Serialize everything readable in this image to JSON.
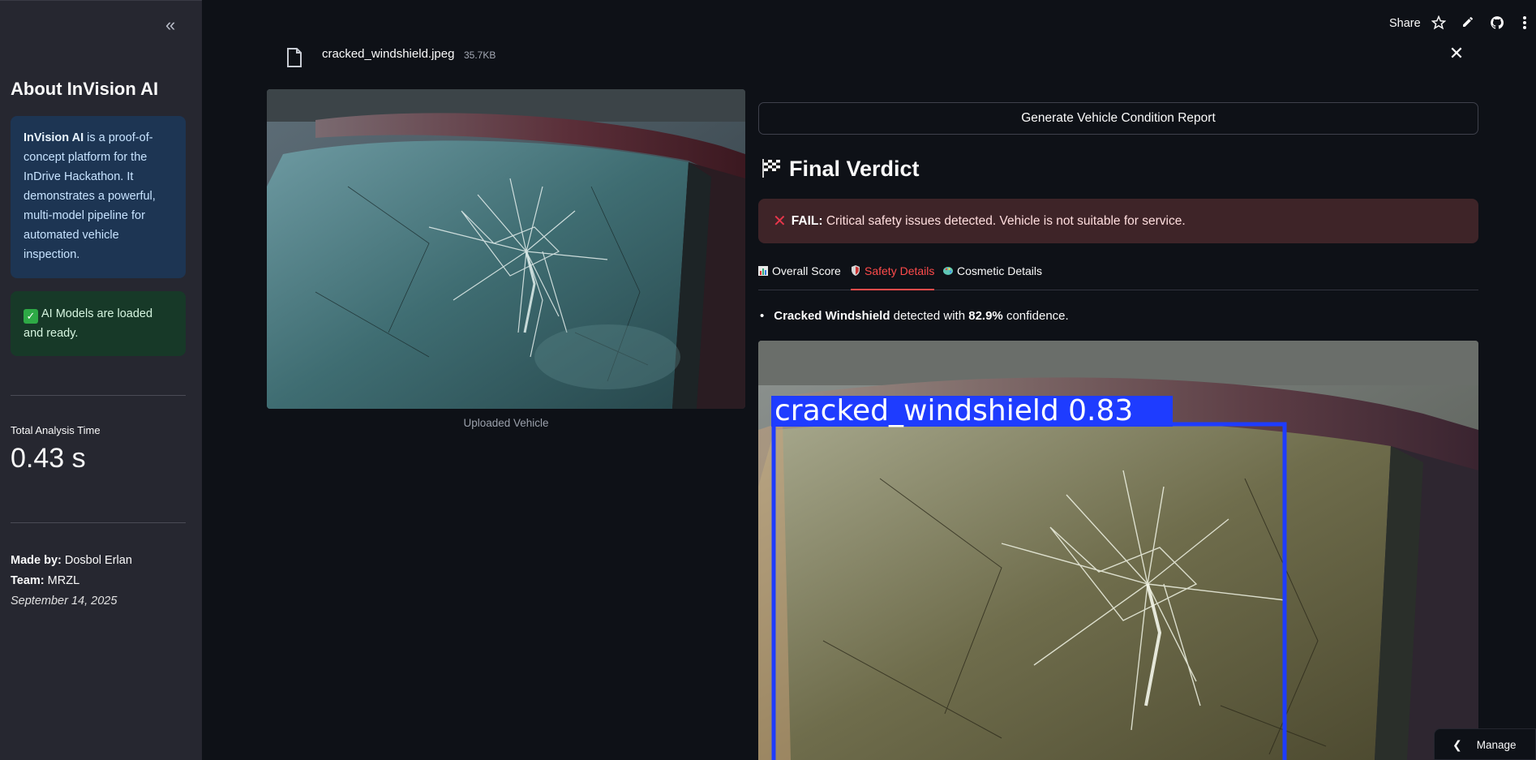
{
  "sidebar": {
    "collapse_icon": "«",
    "title": "About InVision AI",
    "info": {
      "bold": "InVision AI",
      "text": " is a proof-of-concept platform for the InDrive Hackathon. It demonstrates a powerful, multi-model pipeline for automated vehicle inspection."
    },
    "status": "AI Models are loaded and ready.",
    "metric": {
      "label": "Total Analysis Time",
      "value": "0.43 s"
    },
    "credits": {
      "made_by_label": "Made by:",
      "made_by_value": " Dosbol Erlan",
      "team_label": "Team:",
      "team_value": " MRZL",
      "date": "September 14, 2025"
    }
  },
  "header": {
    "share": "Share",
    "icons": [
      "star-icon",
      "edit-icon",
      "github-icon",
      "more-icon"
    ]
  },
  "file": {
    "name": "cracked_windshield.jpeg",
    "size": "35.7KB"
  },
  "uploaded": {
    "caption": "Uploaded Vehicle"
  },
  "main": {
    "generate_button": "Generate Vehicle Condition Report",
    "verdict_title": "Final Verdict",
    "fail": {
      "label": "FAIL:",
      "message": " Critical safety issues detected. Vehicle is not suitable for service."
    },
    "tabs": [
      {
        "label": "Overall Score",
        "active": false
      },
      {
        "label": "Safety Details",
        "active": true
      },
      {
        "label": "Cosmetic Details",
        "active": false
      }
    ],
    "detection": {
      "label": "Cracked Windshield",
      "middle": " detected with ",
      "confidence": "82.9%",
      "end": " confidence."
    },
    "bbox_label": "cracked_windshield 0.83"
  },
  "manage_app": "Manage app",
  "colors": {
    "accent": "#ff4b4b",
    "bbox": "#1e3cff",
    "sidebar_bg": "#262730",
    "app_bg": "#0e1117"
  }
}
